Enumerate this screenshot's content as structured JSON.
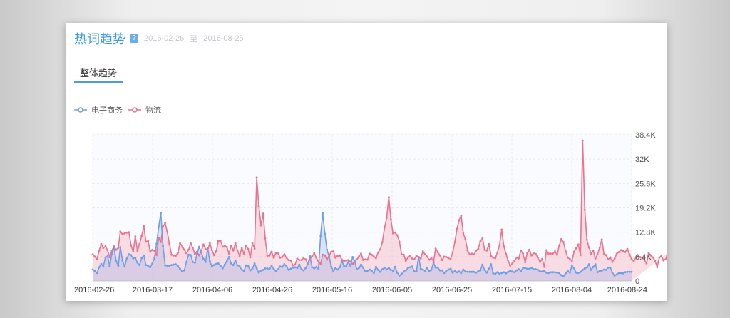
{
  "header": {
    "title": "热词趋势",
    "help_symbol": "?",
    "start_date": "2016-02-26",
    "separator": "至",
    "end_date": "2016-08-25"
  },
  "tabs": [
    {
      "label": "整体趋势",
      "active": true
    }
  ],
  "chart_data": {
    "type": "area",
    "x_ticks": [
      "2016-02-26",
      "2016-03-17",
      "2016-04-06",
      "2016-04-26",
      "2016-05-16",
      "2016-06-05",
      "2016-06-25",
      "2016-07-15",
      "2016-08-04",
      "2016-08-24"
    ],
    "y_ticks": [
      "38.4K",
      "32K",
      "25.6K",
      "19.2K",
      "12.8K",
      "6.4K",
      "0"
    ],
    "ylim": [
      0,
      38400
    ],
    "legend_placement": "top-left",
    "grid": true,
    "series": [
      {
        "name": "电子商务",
        "color": "#6d9eea",
        "fill": "rgba(150,170,230,0.30)",
        "values": [
          3000,
          2600,
          2100,
          3600,
          4500,
          3800,
          6200,
          6500,
          3900,
          7200,
          8800,
          5200,
          4000,
          8900,
          5400,
          3800,
          5900,
          7000,
          6800,
          5900,
          6100,
          4800,
          4200,
          6000,
          6700,
          4200,
          4000,
          3600,
          4600,
          6000,
          9800,
          14200,
          17800,
          9200,
          4100,
          4000,
          4000,
          4200,
          4300,
          4400,
          3900,
          3200,
          2500,
          2800,
          5000,
          6900,
          6800,
          5000,
          4800,
          7100,
          9000,
          7500,
          5800,
          5000,
          8600,
          5200,
          3800,
          4200,
          4500,
          4600,
          4000,
          3300,
          4300,
          5200,
          6300,
          4600,
          4200,
          5400,
          4100,
          3800,
          3000,
          2600,
          4100,
          3900,
          2800,
          3300,
          4600,
          3300,
          2200,
          2700,
          2900,
          3300,
          3300,
          3100,
          4000,
          3200,
          2600,
          3100,
          3800,
          3700,
          4400,
          3800,
          2900,
          3200,
          3500,
          3600,
          3400,
          4300,
          3100,
          2800,
          3400,
          4400,
          6500,
          3600,
          3300,
          3700,
          3200,
          11800,
          17800,
          12400,
          8200,
          6400,
          3800,
          2600,
          3400,
          3000,
          3600,
          5200,
          3900,
          3800,
          5000,
          4000,
          6300,
          5100,
          3100,
          3400,
          4300,
          3500,
          2500,
          2700,
          3000,
          2600,
          2100,
          3700,
          2900,
          2400,
          3100,
          3500,
          3000,
          3500,
          2900,
          2700,
          3700,
          2200,
          1400,
          1900,
          2500,
          2800,
          3400,
          3600,
          3800,
          2500,
          2600,
          6300,
          3200,
          3000,
          2700,
          3400,
          2600,
          2900,
          4800,
          3500,
          3500,
          2800,
          2800,
          2100,
          2700,
          3000,
          3200,
          2200,
          2600,
          2300,
          2500,
          2100,
          3000,
          2500,
          2400,
          2400,
          2400,
          2400,
          2200,
          2600,
          2800,
          4300,
          2900,
          2200,
          3200,
          4400,
          2000,
          1900,
          2300,
          1900,
          2100,
          2300,
          2000,
          2400,
          2700,
          2500,
          2300,
          2800,
          3100,
          2600,
          3400,
          3400,
          3200,
          3200,
          3400,
          3100,
          3100,
          2900,
          2500,
          2500,
          2700,
          2200,
          2100,
          2300,
          2300,
          2300,
          2200,
          2100,
          1500,
          1300,
          2000,
          2700,
          2200,
          4000,
          3300,
          2200,
          2100,
          2400,
          2900,
          3300,
          3500,
          4400,
          2900,
          3700,
          4400,
          2300,
          2600,
          2700,
          3000,
          2900,
          3500,
          3500,
          2200,
          1400,
          1700,
          2100,
          2100,
          2000,
          2300,
          2400,
          2400,
          2400
        ]
      },
      {
        "name": "物流",
        "color": "#e87590",
        "fill": "rgba(244,170,184,0.38)",
        "values": [
          7000,
          6400,
          5700,
          7900,
          9700,
          8700,
          9100,
          8100,
          6200,
          8000,
          9100,
          8200,
          8700,
          13000,
          12300,
          12500,
          12700,
          12800,
          9400,
          7700,
          11700,
          7900,
          9700,
          11800,
          14400,
          10300,
          10500,
          7700,
          8200,
          7900,
          6800,
          11300,
          10200,
          14300,
          15200,
          12900,
          9800,
          6900,
          6700,
          6600,
          7400,
          9900,
          9200,
          8200,
          7300,
          8200,
          9900,
          8700,
          7100,
          7700,
          6700,
          7900,
          9600,
          8400,
          8100,
          10000,
          8100,
          6800,
          7800,
          10500,
          10600,
          9000,
          9300,
          8900,
          7200,
          9300,
          8000,
          9900,
          7900,
          6600,
          8800,
          7100,
          9300,
          8400,
          6200,
          9900,
          8500,
          27200,
          19600,
          14600,
          17700,
          11200,
          6600,
          6700,
          7700,
          6100,
          7300,
          7300,
          6100,
          6300,
          7000,
          6100,
          5500,
          5400,
          4100,
          4300,
          5900,
          5500,
          5500,
          6000,
          5700,
          4500,
          5700,
          6500,
          7300,
          6100,
          5100,
          4500,
          6900,
          6700,
          5600,
          6700,
          7700,
          7800,
          6100,
          6600,
          6700,
          5600,
          5200,
          5400,
          5500,
          5100,
          4500,
          5400,
          5700,
          6400,
          7200,
          5500,
          5700,
          5600,
          7200,
          6900,
          6400,
          6000,
          7500,
          8300,
          10200,
          14000,
          16600,
          22000,
          16200,
          12500,
          12700,
          12000,
          10300,
          7000,
          6900,
          5300,
          6200,
          6600,
          5900,
          5700,
          6600,
          6300,
          5900,
          7800,
          7000,
          6400,
          5600,
          6000,
          5200,
          8500,
          7600,
          6700,
          5500,
          6400,
          6300,
          6000,
          5800,
          7500,
          10200,
          13700,
          16000,
          17100,
          12500,
          10900,
          8000,
          7000,
          7200,
          7000,
          8000,
          8500,
          10400,
          11200,
          8200,
          8000,
          9700,
          6600,
          6100,
          6000,
          7500,
          9400,
          13500,
          9100,
          7100,
          5400,
          4000,
          4600,
          5300,
          6100,
          5900,
          8000,
          7200,
          4900,
          7300,
          8200,
          6700,
          7300,
          7100,
          6100,
          5000,
          5800,
          3700,
          8100,
          7200,
          7200,
          7200,
          7800,
          6900,
          9300,
          11000,
          10200,
          7800,
          6100,
          5800,
          5300,
          7700,
          8600,
          9600,
          6800,
          36900,
          18700,
          10800,
          8800,
          7200,
          7900,
          5900,
          7000,
          8800,
          10900,
          7100,
          6800,
          5700,
          6200,
          5000,
          5900,
          7200,
          7600,
          8100,
          7900,
          7600,
          8400,
          7000,
          5800,
          5200,
          6200,
          6500,
          6300,
          6000,
          5600,
          4600,
          7400,
          6700,
          6200,
          5300,
          3600,
          6200,
          6600,
          5400,
          5700,
          7400
        ]
      }
    ]
  }
}
